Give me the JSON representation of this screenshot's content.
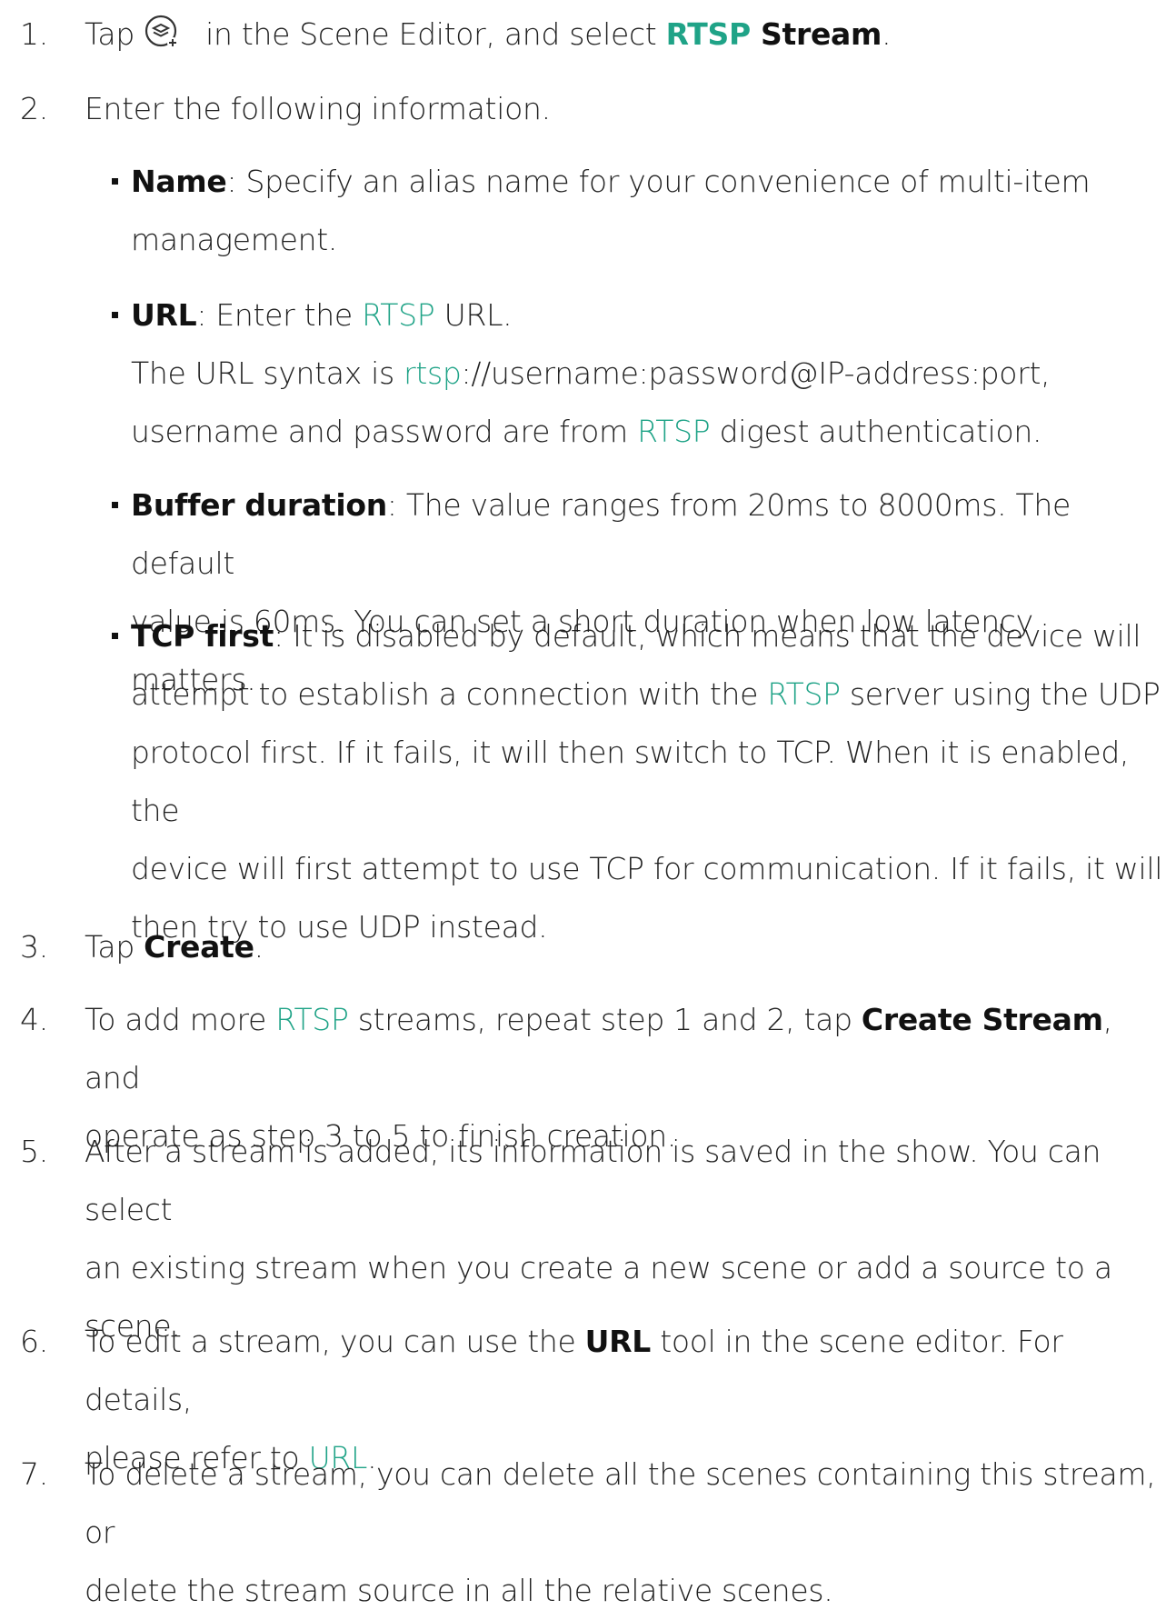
{
  "steps": [
    {
      "num": "1.",
      "before_icon": "Tap",
      "icon": "add-layer-icon",
      "after_icon": " in the Scene Editor, and select ",
      "link": "RTSP",
      "bold": " Stream",
      "end": "."
    },
    {
      "num": "2.",
      "text": "Enter the following information."
    },
    {
      "num": "3.",
      "pre": "Tap ",
      "bold": "Create",
      "end": "."
    },
    {
      "num": "4.",
      "pre": "To add more ",
      "link": "RTSP",
      "mid": " streams, repeat step 1 and 2, tap ",
      "bold": "Create Stream",
      "line1_end": ", and",
      "line2": "operate as step 3 to 5 to finish creation."
    },
    {
      "num": "5.",
      "line1": "After a stream is added, its information is saved in the show. You can select",
      "line2": "an existing stream when you create a new scene or add a source to a",
      "line3": "scene."
    },
    {
      "num": "6.",
      "pre": "To edit a stream, you can use the ",
      "bold": "URL",
      "line1_end": " tool in the scene editor. For details,",
      "line2_pre": "please refer to ",
      "link": "URL",
      "end": "."
    },
    {
      "num": "7.",
      "line1": "To delete a stream, you can delete all the scenes containing this stream, or",
      "line2": "delete the stream source in all the relative scenes."
    }
  ],
  "fields": [
    {
      "label": "Name",
      "line1": ": Specify an alias name for your convenience of multi-item",
      "line2": "management."
    },
    {
      "label": "URL",
      "line1_pre": ": Enter the ",
      "link": "RTSP",
      "line1_end": " URL.",
      "line2_pre": "The URL syntax is ",
      "link2": "rtsp",
      "line2_end": "://username:password@IP-address:port,",
      "line3_pre": "username and password are from ",
      "link3": "RTSP",
      "line3_end": " digest authentication."
    },
    {
      "label": "Buffer duration",
      "line1": ": The value ranges from 20ms to 8000ms. The default",
      "line2": "value is 60ms. You can set a short duration when low latency matters."
    },
    {
      "label": "TCP first",
      "line1": ": It is disabled by default, which means that the device will",
      "line2_pre": "attempt to establish a connection with the ",
      "link": "RTSP",
      "line2_end": " server using the UDP",
      "line3": "protocol first. If it fails, it will then switch to TCP. When it is enabled, the",
      "line4": "device will first attempt to use TCP for communication. If it fails, it will",
      "line5": "then try to use UDP instead."
    }
  ],
  "colors": {
    "link": "#1fa387",
    "text": "#222222"
  }
}
